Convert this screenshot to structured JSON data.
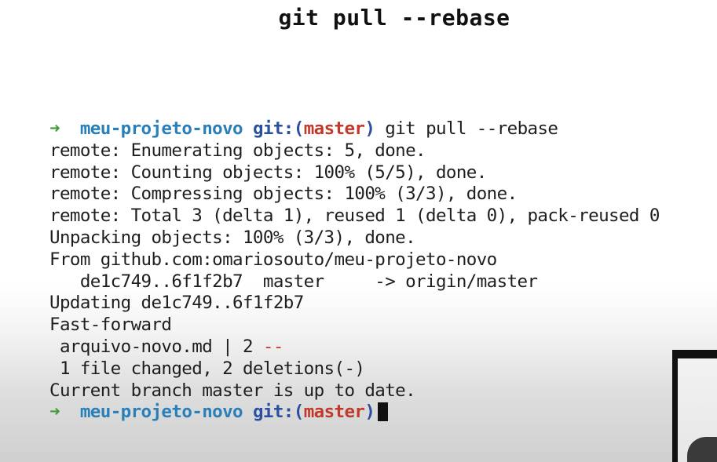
{
  "slide": {
    "title": "git pull --rebase"
  },
  "terminal": {
    "prompt_arrow": "➜",
    "prompt_dir": "meu-projeto-novo",
    "prompt_git": "git:(",
    "prompt_branch": "master",
    "prompt_close": ")",
    "command": "git pull --rebase",
    "output": [
      "remote: Enumerating objects: 5, done.",
      "remote: Counting objects: 100% (5/5), done.",
      "remote: Compressing objects: 100% (3/3), done.",
      "remote: Total 3 (delta 1), reused 1 (delta 0), pack-reused 0",
      "Unpacking objects: 100% (3/3), done.",
      "From github.com:omariosouto/meu-projeto-novo",
      "   de1c749..6f1f2b7  master     -> origin/master",
      "Updating de1c749..6f1f2b7",
      "Fast-forward"
    ],
    "diffstat_file": " arquivo-novo.md | 2 ",
    "diffstat_bar": "--",
    "summary": " 1 file changed, 2 deletions(-)",
    "status": "Current branch master is up to date."
  },
  "colors": {
    "prompt_arrow": "#3d9a3a",
    "prompt_dir": "#2a7fb8",
    "prompt_git": "#2a4f9e",
    "prompt_branch": "#c0392b"
  }
}
